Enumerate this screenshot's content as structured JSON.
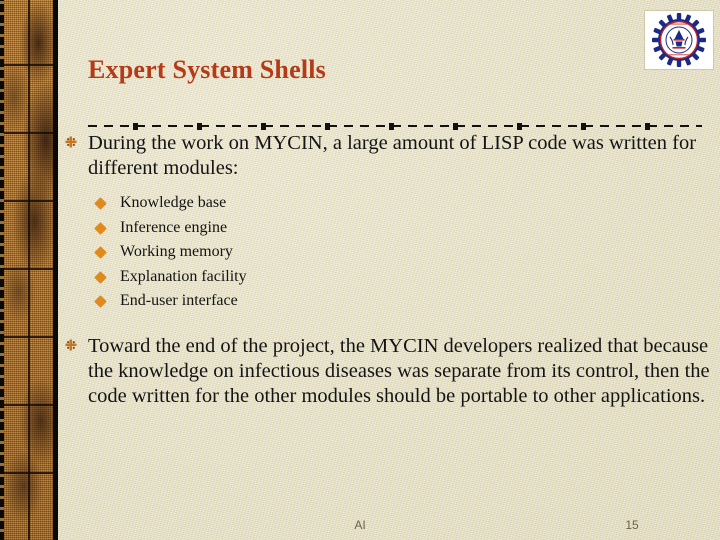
{
  "slide": {
    "title": "Expert System Shells",
    "title_color": "#b43a18",
    "background_color": "#e9e4c9"
  },
  "logo": {
    "name": "institute-seal-logo",
    "outer_text": "ACE ENGINEERING COLLEGE",
    "inner_text": "HYDERABAD"
  },
  "body": {
    "bullet1": {
      "text": "During the work on MYCIN, a large amount of LISP code was written for different modules:",
      "marker": "burst-bullet-icon"
    },
    "sub_items": [
      {
        "label": "Knowledge base"
      },
      {
        "label": "Inference engine"
      },
      {
        "label": "Working memory"
      },
      {
        "label": "Explanation facility"
      },
      {
        "label": "End-user interface"
      }
    ],
    "bullet2": {
      "text": "Toward the end of the project, the MYCIN developers realized that because the knowledge on infectious diseases was separate from its control, then the code written for the other modules should be portable to other applications.",
      "marker": "burst-bullet-icon"
    },
    "sub_marker": "diamond-bullet-icon",
    "sub_marker_color": "#e08a1e"
  },
  "footer": {
    "label": "AI",
    "page_number": "15"
  }
}
